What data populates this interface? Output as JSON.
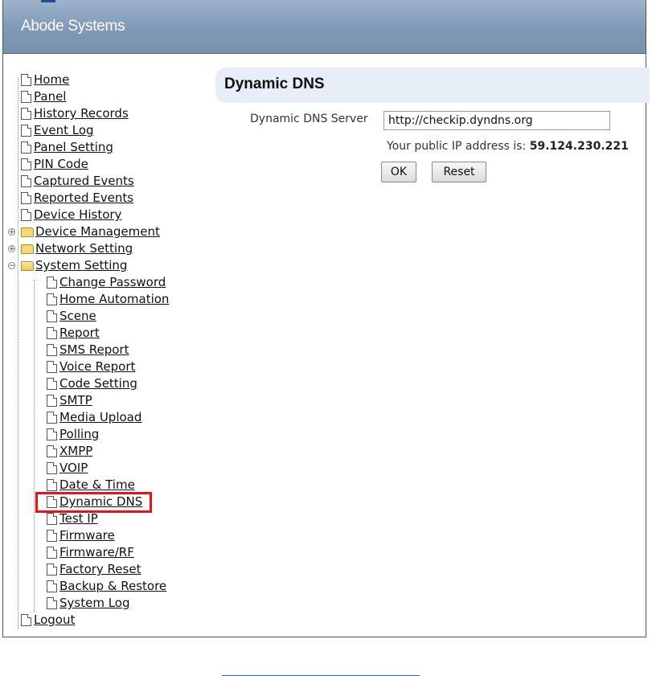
{
  "header": {
    "title": "Abode Systems"
  },
  "tree": {
    "root_items": [
      {
        "label": "Home"
      },
      {
        "label": "Panel"
      },
      {
        "label": "History Records"
      },
      {
        "label": "Event Log"
      },
      {
        "label": "Panel Setting"
      },
      {
        "label": "PIN Code"
      },
      {
        "label": "Captured Events"
      },
      {
        "label": "Reported Events"
      },
      {
        "label": "Device History"
      }
    ],
    "folders": [
      {
        "label": "Device Management",
        "expanded": false
      },
      {
        "label": "Network Setting",
        "expanded": false
      },
      {
        "label": "System Setting",
        "expanded": true
      }
    ],
    "system_setting_children": [
      {
        "label": "Change Password"
      },
      {
        "label": "Home Automation"
      },
      {
        "label": "Scene"
      },
      {
        "label": "Report"
      },
      {
        "label": "SMS Report"
      },
      {
        "label": "Voice Report"
      },
      {
        "label": "Code Setting"
      },
      {
        "label": "SMTP"
      },
      {
        "label": "Media Upload"
      },
      {
        "label": "Polling"
      },
      {
        "label": "XMPP"
      },
      {
        "label": "VOIP"
      },
      {
        "label": "Date & Time"
      },
      {
        "label": "Dynamic DNS",
        "highlighted": true
      },
      {
        "label": "Test IP"
      },
      {
        "label": "Firmware"
      },
      {
        "label": "Firmware/RF"
      },
      {
        "label": "Factory Reset"
      },
      {
        "label": "Backup & Restore"
      },
      {
        "label": "System Log"
      }
    ],
    "logout": {
      "label": "Logout"
    }
  },
  "content": {
    "title": "Dynamic DNS",
    "server_label": "Dynamic DNS Server",
    "server_value": "http://checkip.dyndns.org",
    "ip_prefix": "Your public IP address is:",
    "ip_value": "59.124.230.221",
    "ok_label": "OK",
    "reset_label": "Reset"
  },
  "colors": {
    "header_bg": "#8aa3bf",
    "highlight_border": "#e8121b",
    "title_bar_bg": "#e7eef7"
  }
}
